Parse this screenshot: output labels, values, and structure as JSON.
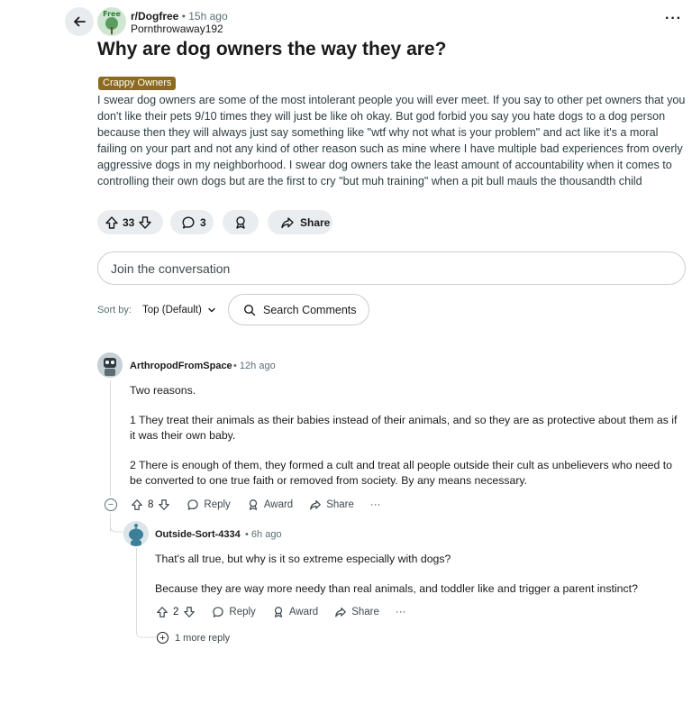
{
  "post": {
    "subreddit": "r/Dogfree",
    "time": "15h ago",
    "author": "Pornthrowaway192",
    "avatar_text": "Free",
    "title": "Why are dog owners the way they are?",
    "flair": "Crappy Owners",
    "body": "I swear dog owners are some of the most intolerant people you will ever meet. If you say to other pet owners that you don't like their pets 9/10 times they will just be like oh okay. But god forbid you say you hate dogs to a dog person because then they will always just say something like \"wtf why not what is your problem\" and act like it's a moral failing on your part and not any kind of other reason such as mine where I have multiple bad experiences from overly aggressive dogs in my neighborhood. I swear dog owners take the least amount of accountability when it comes to controlling their own dogs but are the first to cry \"but muh training\" when a pit bull mauls the thousandth child",
    "votes": "33",
    "comments": "3",
    "share_label": "Share",
    "more_icon": "···"
  },
  "join_placeholder": "Join the conversation",
  "sort": {
    "label": "Sort by:",
    "value": "Top (Default)"
  },
  "search_comments": "Search Comments",
  "comments": [
    {
      "author": "ArthropodFromSpace",
      "time": "12h ago",
      "paragraphs": [
        "Two reasons.",
        "1 They treat their animals as their babies instead of their animals, and so they are as protective about them as if it was their own baby.",
        "2 There is enough of them, they formed a cult and treat all people outside their cult as unbelievers who need to be converted to one true faith or removed from society. By any means necessary."
      ],
      "votes": "8",
      "reply_label": "Reply",
      "award_label": "Award",
      "share_label": "Share",
      "more_icon": "···"
    },
    {
      "author": "Outside-Sort-4334",
      "time": "6h ago",
      "paragraphs": [
        "That's all true, but why is it so extreme especially with dogs?",
        "Because they are way more needy than real animals, and toddler like and trigger a parent instinct?"
      ],
      "votes": "2",
      "reply_label": "Reply",
      "award_label": "Award",
      "share_label": "Share",
      "more_icon": "···"
    }
  ],
  "more_replies": "1 more reply",
  "dot_separator": "•",
  "icons": [
    "back-arrow-icon",
    "upvote-icon",
    "downvote-icon",
    "comment-icon",
    "award-icon",
    "share-icon",
    "chevron-down-icon",
    "search-icon",
    "collapse-icon",
    "expand-icon",
    "more-icon"
  ]
}
